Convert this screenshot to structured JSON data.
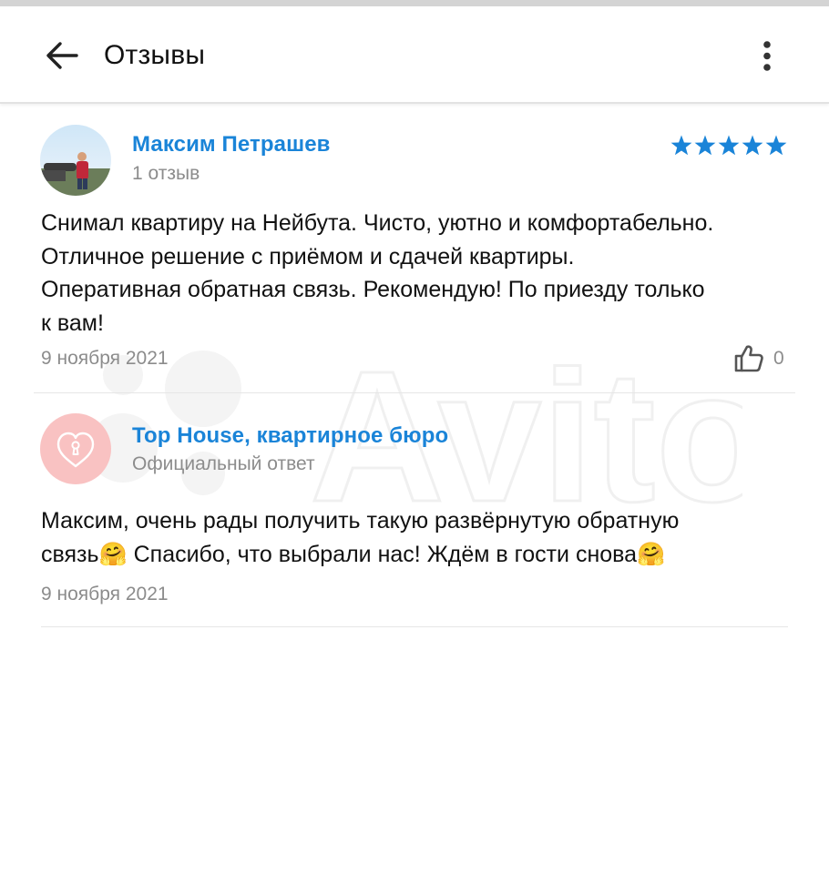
{
  "header": {
    "title": "Отзывы",
    "back_icon": "arrow-left-icon",
    "menu_icon": "more-vertical-icon"
  },
  "watermark": {
    "text": "Avito"
  },
  "review": {
    "author": "Максим Петрашев",
    "reviews_count": "1 отзыв",
    "rating": 5,
    "rating_max": 5,
    "text_lines": [
      "Снимал квартиру на Нейбута. Чисто, уютно и комфортабельно.",
      "Отличное решение с приёмом и сдачей квартиры.",
      "Оперативная обратная связь. Рекомендую! По приезду только",
      "к вам!"
    ],
    "date": "9 ноября 2021",
    "likes": "0",
    "like_icon": "thumbs-up-icon"
  },
  "reply": {
    "author": "Top House, квартирное бюро",
    "label": "Официальный ответ",
    "text_lines": [
      "Максим, очень рады получить такую развёрнутую обратную",
      "связь🤗 Спасибо, что выбрали нас! Ждём в гости снова🤗"
    ],
    "date": "9 ноября 2021",
    "avatar_icon": "heart-keyhole-icon"
  },
  "colors": {
    "accent": "#1a84d8",
    "star": "#1a84d8",
    "muted_text": "#8c8c8c",
    "reply_avatar_bg": "#f9c2c2"
  }
}
